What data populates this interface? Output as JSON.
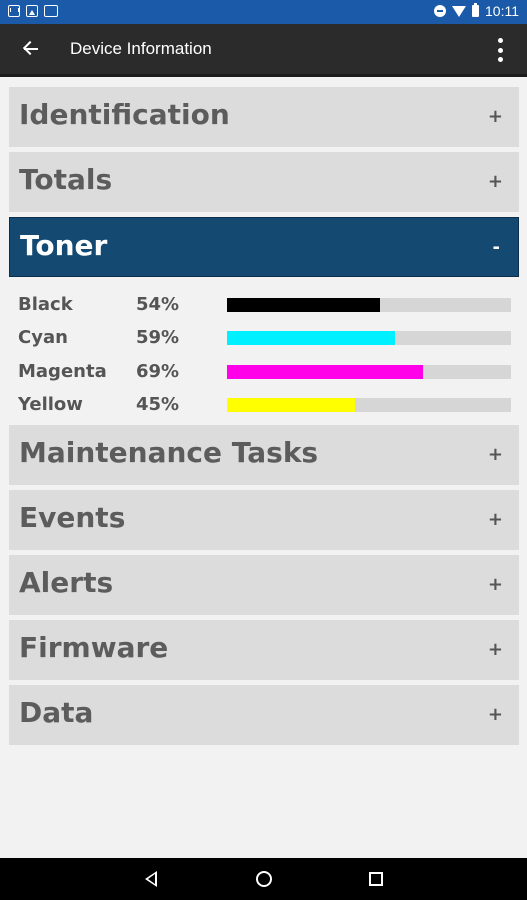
{
  "status_bar": {
    "time": "10:11",
    "left_icons": [
      "gmail-icon",
      "image-icon",
      "sms-icon"
    ],
    "right_icons": [
      "do-not-disturb-icon",
      "wifi-icon",
      "battery-icon"
    ]
  },
  "app_bar": {
    "title": "Device Information",
    "back_icon": "arrow-back-icon",
    "menu_icon": "more-vert-icon"
  },
  "sections": [
    {
      "title": "Identification",
      "sign": "+",
      "expanded": false
    },
    {
      "title": "Totals",
      "sign": "+",
      "expanded": false
    },
    {
      "title": "Toner",
      "sign": "-",
      "expanded": true
    },
    {
      "title": "Maintenance Tasks",
      "sign": "+",
      "expanded": false
    },
    {
      "title": "Events",
      "sign": "+",
      "expanded": false
    },
    {
      "title": "Alerts",
      "sign": "+",
      "expanded": false
    },
    {
      "title": "Firmware",
      "sign": "+",
      "expanded": false
    },
    {
      "title": "Data",
      "sign": "+",
      "expanded": false
    }
  ],
  "toner": [
    {
      "name": "Black",
      "percent_label": "54%",
      "level": 0.54,
      "color": "#000000"
    },
    {
      "name": "Cyan",
      "percent_label": "59%",
      "level": 0.59,
      "color": "#00f0ff"
    },
    {
      "name": "Magenta",
      "percent_label": "69%",
      "level": 0.69,
      "color": "#ff00e8"
    },
    {
      "name": "Yellow",
      "percent_label": "45%",
      "level": 0.45,
      "color": "#ffff00"
    }
  ],
  "colors": {
    "status_bar": "#1a5aa8",
    "app_bar": "#2b2b2b",
    "section_bg": "#dcdcdc",
    "section_open_bg": "#144a72",
    "bar_track": "#d6d6d6"
  },
  "nav_bar": {
    "icons": [
      "nav-back-icon",
      "nav-home-icon",
      "nav-recents-icon"
    ]
  }
}
